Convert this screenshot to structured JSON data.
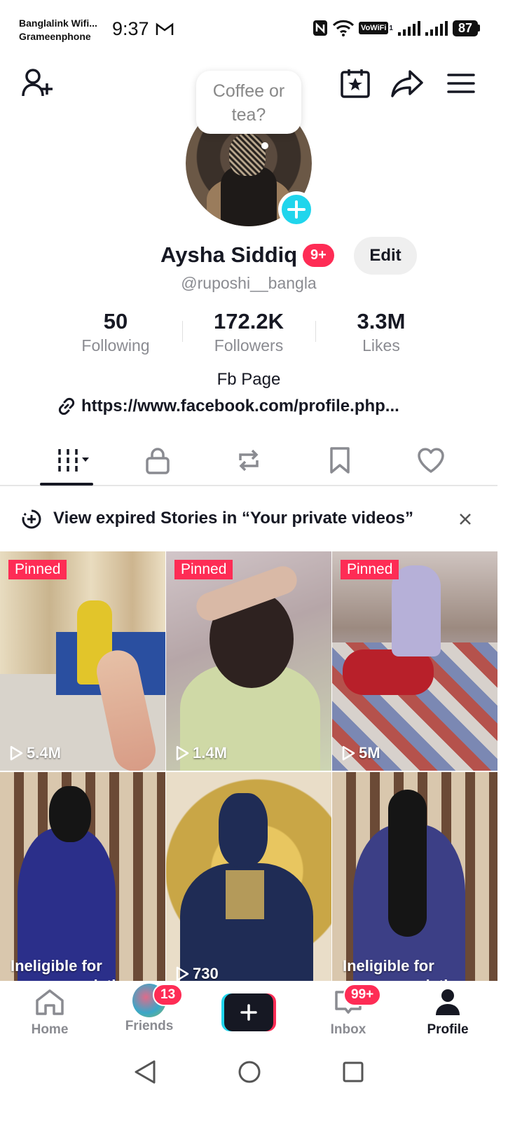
{
  "status_bar": {
    "carrier_1": "Banglalink Wifi...",
    "carrier_2": "Grameenphone",
    "time": "9:37",
    "vowifi": "VoWiFi",
    "vowifi_sub": "1",
    "battery": "87"
  },
  "speech_bubble": {
    "line_1": "Coffee or",
    "line_2": "tea?"
  },
  "profile": {
    "name": "Aysha Siddiq",
    "notification_badge": "9+",
    "edit_label": "Edit",
    "handle": "@ruposhi__bangla",
    "bio": "Fb Page",
    "link": "https://www.facebook.com/profile.php..."
  },
  "stats": [
    {
      "value": "50",
      "label": "Following"
    },
    {
      "value": "172.2K",
      "label": "Followers"
    },
    {
      "value": "3.3M",
      "label": "Likes"
    }
  ],
  "tabs": [
    "videos-grid",
    "private",
    "reposts",
    "favorites",
    "liked"
  ],
  "banner": {
    "text": "View expired Stories in “Your private videos”"
  },
  "videos": [
    {
      "pinned": "Pinned",
      "views": "5.4M"
    },
    {
      "pinned": "Pinned",
      "views": "1.4M"
    },
    {
      "pinned": "Pinned",
      "views": "5M"
    },
    {
      "note": "Ineligible for recommendation"
    },
    {
      "views": "730"
    },
    {
      "note": "Ineligible for recommendation"
    }
  ],
  "bottom_nav": {
    "home": "Home",
    "friends": "Friends",
    "friends_badge": "13",
    "inbox": "Inbox",
    "inbox_badge": "99+",
    "profile": "Profile"
  },
  "colors": {
    "accent_red": "#fe2c55",
    "accent_cyan": "#20d5ec",
    "text_primary": "#161823",
    "text_secondary": "#8a8b91"
  }
}
